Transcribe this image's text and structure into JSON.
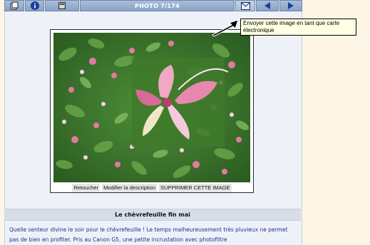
{
  "toolbar": {
    "photo_counter": "PHOTO 7/174",
    "icons": [
      "gallery-icon",
      "info-icon",
      "slideshow-icon",
      "email-card-icon",
      "previous-arrow-icon",
      "next-arrow-icon"
    ]
  },
  "photo": {
    "subject": "honeysuckle-flowers"
  },
  "actions": {
    "retouch": "Retoucher",
    "edit_description": "Modifier la description",
    "delete_image": "SUPPRIMER CETTE IMAGE"
  },
  "photo_title": "Le chèvrefeuille fin mai",
  "description": "Quelle senteur divine le soir pour le chèvrefeuille ! Le temps malheureusement très pluvieux ne permet pas de bien en profiter. Pris au Canon G5, une petite incrustation avec photofiltre",
  "tooltip": "Envoyer cette image en tant que carte électronique",
  "colors": {
    "toolbar": "#8aa3c6",
    "panel": "#eef2f8",
    "page_background": "#fdf5e6",
    "description_text": "#1f2f8f",
    "title_bar": "#d6dde8"
  }
}
